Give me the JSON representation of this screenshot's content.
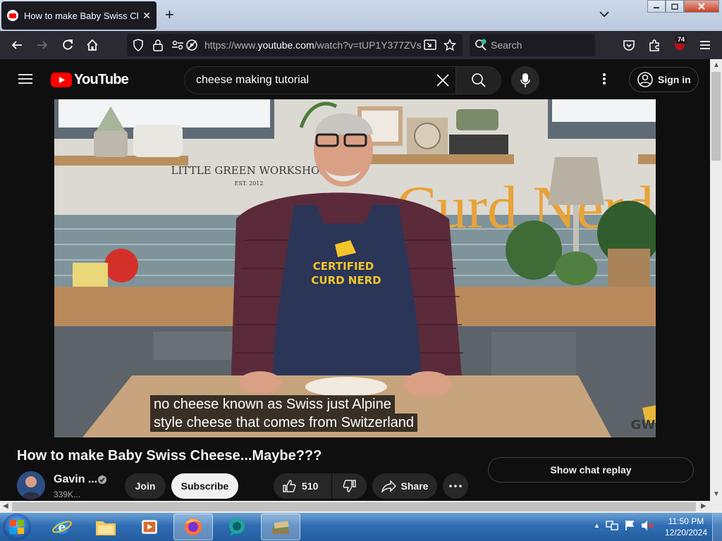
{
  "browser": {
    "tab_title": "How to make Baby Swiss Cheese...Maybe??? - YouTube",
    "new_tab_icon": "plus-icon",
    "url_prefix": "https://www.",
    "url_domain": "youtube.com",
    "url_path": "/watch?v=tUP1Y377ZVs",
    "search_placeholder": "Search",
    "extensions_badge": "74"
  },
  "youtube": {
    "logo_text": "YouTube",
    "search_query": "cheese making tutorial",
    "sign_in_label": "Sign in",
    "accent_color": "#ff0000"
  },
  "video": {
    "title": "How to make Baby Swiss Cheese...Maybe???",
    "subtitles": [
      "no cheese known as Swiss just Alpine",
      "style cheese that comes from Switzerland"
    ],
    "scene_sign_line1": "LITTLE GREEN WORKSHOP",
    "scene_sign_line2": "EST. 2012",
    "apron_line1": "CERTIFIED",
    "apron_line2": "CURD NERD",
    "wall_word": "Curd Nerd",
    "watermark": "GW"
  },
  "channel": {
    "name": "Gavin ...",
    "subscribers": "339K...",
    "join_label": "Join",
    "subscribe_label": "Subscribe"
  },
  "actions": {
    "like_count": "510",
    "share_label": "Share",
    "chat_replay_label": "Show chat replay"
  },
  "taskbar": {
    "time": "11:50 PM",
    "date": "12/20/2024"
  }
}
